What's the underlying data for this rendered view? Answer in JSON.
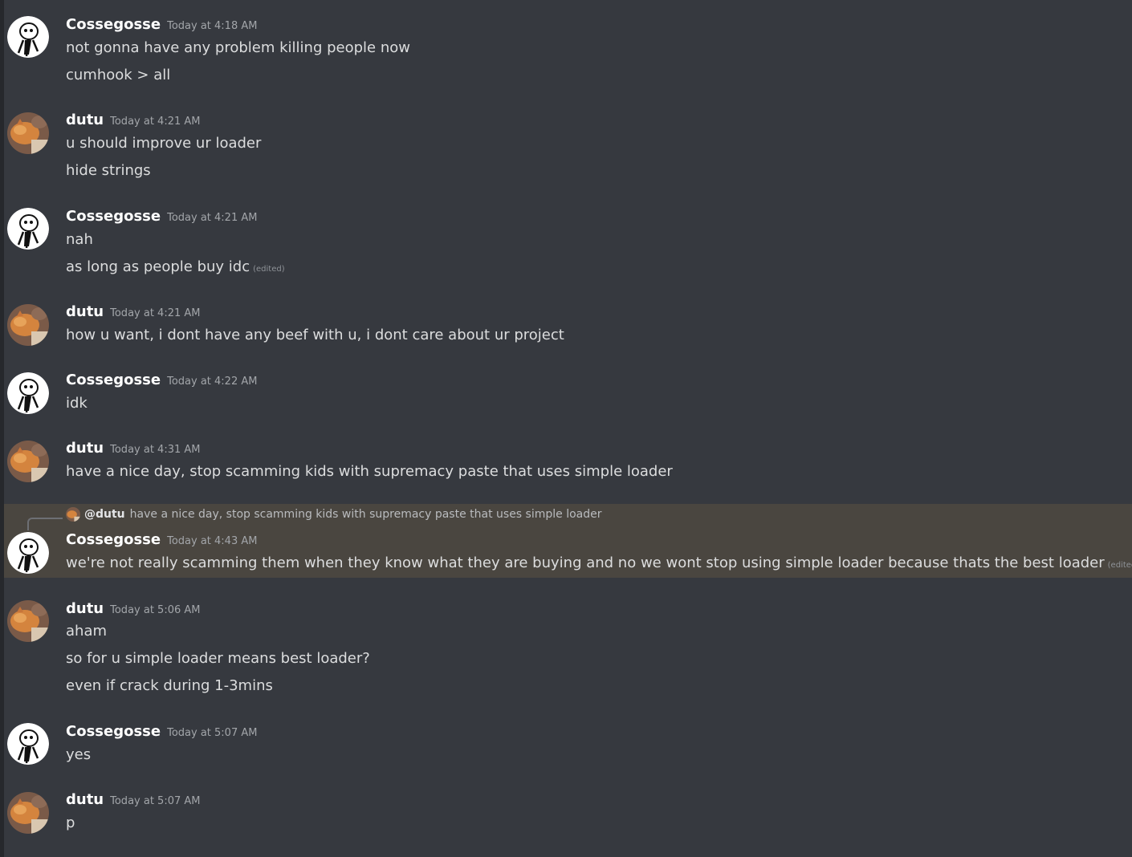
{
  "messages": [
    {
      "username": "Cossegosse",
      "timestamp": "Today at 4:18 AM",
      "avatar": "meme-avatar",
      "lines": [
        "not gonna have any problem killing people now",
        "cumhook > all"
      ]
    },
    {
      "username": "dutu",
      "timestamp": "Today at 4:21 AM",
      "avatar": "cat-avatar",
      "lines": [
        "u should improve ur loader",
        "hide strings"
      ]
    },
    {
      "username": "Cossegosse",
      "timestamp": "Today at 4:21 AM",
      "avatar": "meme-avatar",
      "lines": [
        "nah",
        "as long as people buy idc"
      ],
      "edited_label": "(edited)"
    },
    {
      "username": "dutu",
      "timestamp": "Today at 4:21 AM",
      "avatar": "cat-avatar",
      "lines": [
        "how u want, i dont have any beef with u, i dont care about ur project"
      ]
    },
    {
      "username": "Cossegosse",
      "timestamp": "Today at 4:22 AM",
      "avatar": "meme-avatar",
      "lines": [
        "idk"
      ]
    },
    {
      "username": "dutu",
      "timestamp": "Today at 4:31 AM",
      "avatar": "cat-avatar",
      "lines": [
        "have a nice day, stop scamming kids with supremacy paste that uses simple loader"
      ]
    },
    {
      "username": "Cossegosse",
      "timestamp": "Today at 4:43 AM",
      "avatar": "meme-avatar",
      "reply": {
        "user": "@dutu",
        "text": "have a nice day, stop scamming kids with supremacy paste that uses simple loader"
      },
      "lines": [
        "we're not really scamming them when they know what they are buying and no we wont stop using simple loader because thats the best loader"
      ],
      "edited_label": "(edited)"
    },
    {
      "username": "dutu",
      "timestamp": "Today at 5:06 AM",
      "avatar": "cat-avatar",
      "lines": [
        "aham",
        "so for u simple loader means best loader?",
        "even if crack during 1-3mins"
      ]
    },
    {
      "username": "Cossegosse",
      "timestamp": "Today at 5:07 AM",
      "avatar": "meme-avatar",
      "lines": [
        "yes"
      ]
    },
    {
      "username": "dutu",
      "timestamp": "Today at 5:07 AM",
      "avatar": "cat-avatar",
      "lines": [
        "p"
      ]
    }
  ],
  "colors": {
    "background": "#36393f",
    "highlight": "#4a4640",
    "username": "#ffffff",
    "timestamp": "#a3a6aa",
    "text": "#dcddde"
  }
}
